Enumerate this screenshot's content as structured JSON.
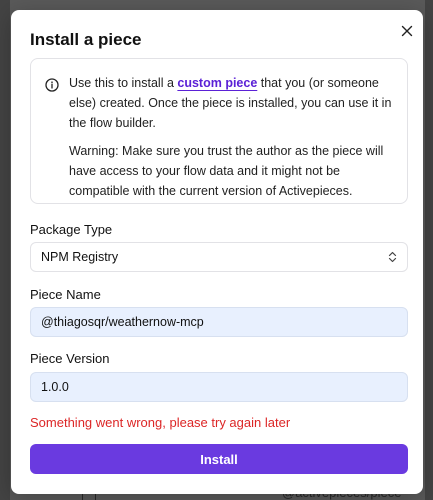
{
  "background": {
    "peek_text": "@activepieces/piece-"
  },
  "modal": {
    "title": "Install a piece",
    "info": {
      "text_before_link": "Use this to install a ",
      "link_text": "custom piece",
      "text_after_link": " that you (or someone else) created. Once the piece is installed, you can use it in the flow builder.",
      "warning": "Warning: Make sure you trust the author as the piece will have access to your flow data and it might not be compatible with the current version of Activepieces."
    },
    "package_type": {
      "label": "Package Type",
      "value": "NPM Registry"
    },
    "piece_name": {
      "label": "Piece Name",
      "value": "@thiagosqr/weathernow-mcp"
    },
    "piece_version": {
      "label": "Piece Version",
      "value": "1.0.0"
    },
    "error": "Something went wrong, please try again later",
    "install_label": "Install"
  },
  "colors": {
    "accent": "#6a3ae0",
    "link": "#5b21d6",
    "error": "#dc2626",
    "input_bg": "#e8f0fe"
  },
  "icons": {
    "close": "close-icon",
    "info": "info-icon",
    "select": "chevron-up-down-icon"
  }
}
